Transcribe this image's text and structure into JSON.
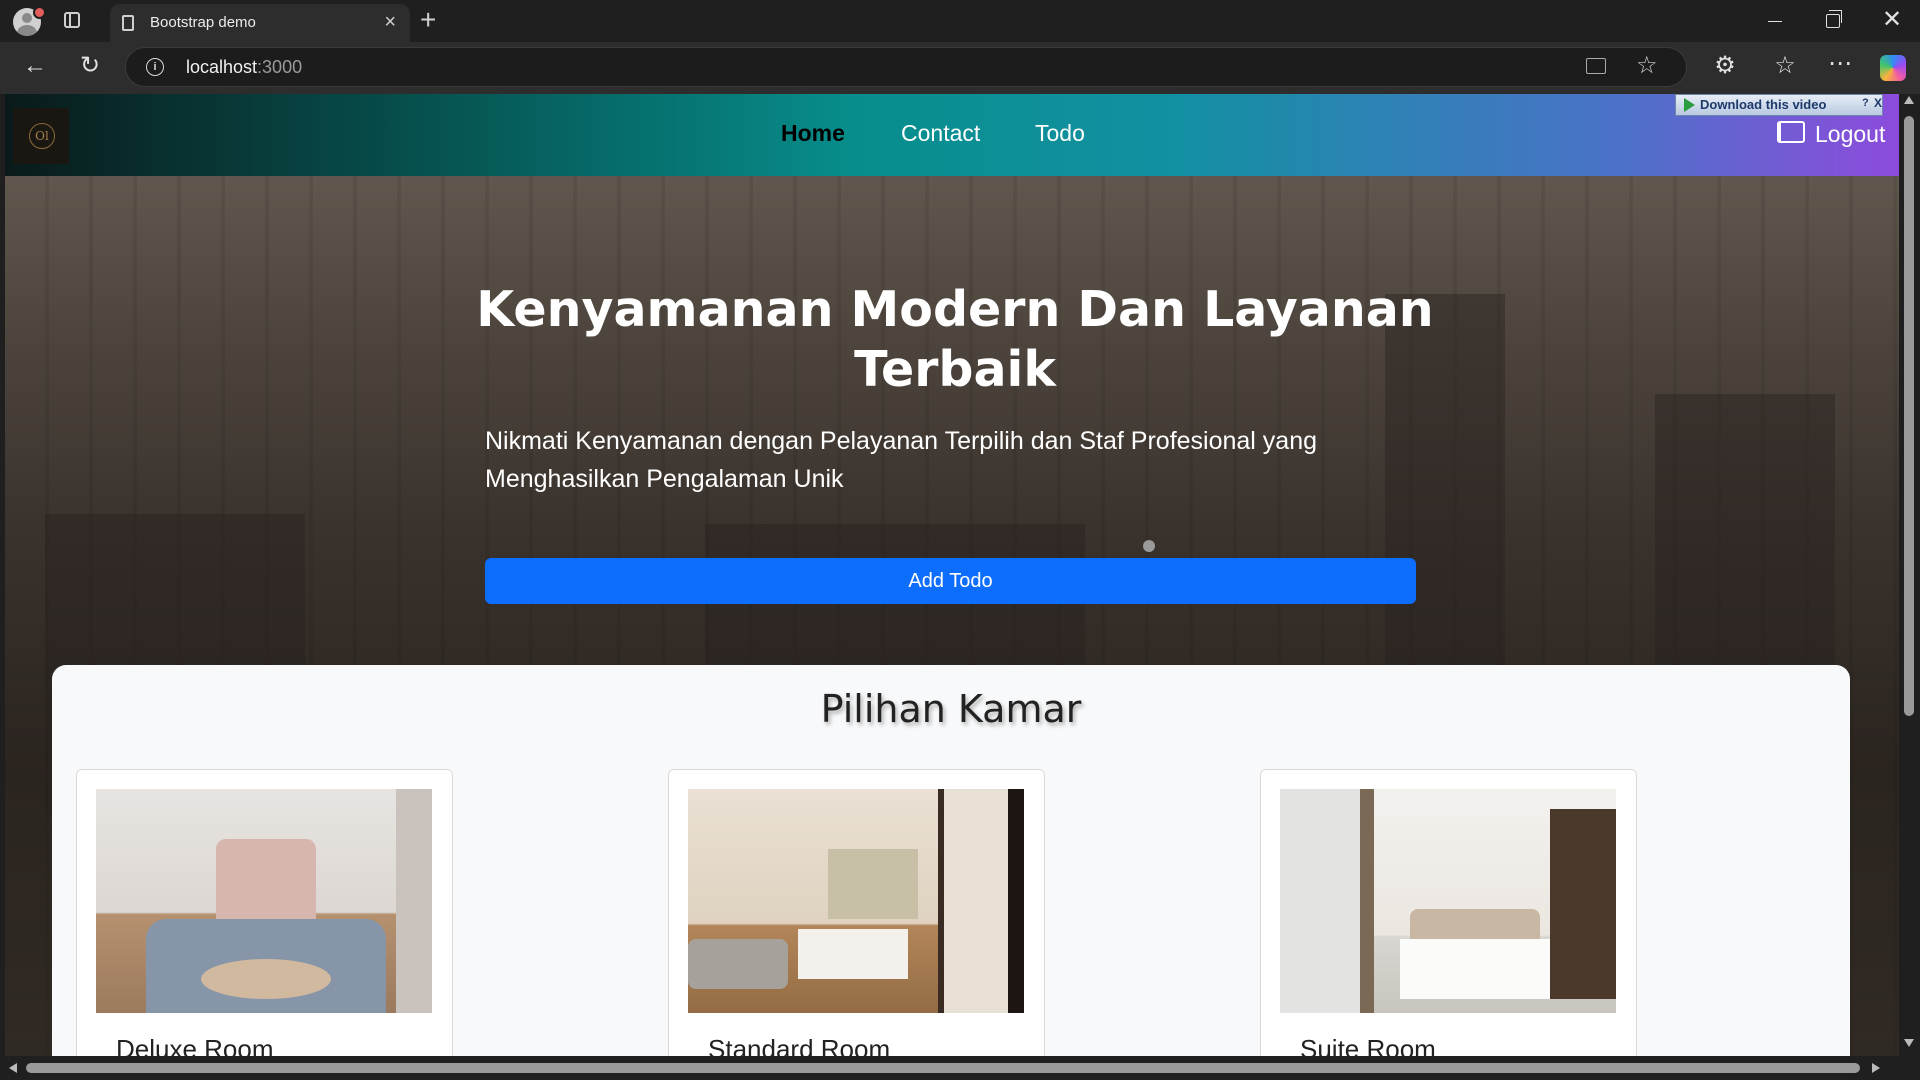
{
  "browser": {
    "tab_title": "Bootstrap demo",
    "tab_close": "×",
    "new_tab": "+",
    "url_host": "localhost",
    "url_port": ":3000",
    "window_close": "✕"
  },
  "toolbar_icons": {
    "back": "←",
    "reload": "↻",
    "extensions": "⚙",
    "favorites": "☆",
    "more": "⋯",
    "star": "☆"
  },
  "navbar": {
    "logo_text": "Ol",
    "links": [
      {
        "label": "Home",
        "active": true
      },
      {
        "label": "Contact",
        "active": false
      },
      {
        "label": "Todo",
        "active": false
      }
    ],
    "logout_label": "Logout"
  },
  "extension_popup": {
    "label": "Download this video",
    "help": "?",
    "close": "X"
  },
  "hero": {
    "title": "Kenyamanan Modern Dan Layanan Terbaik",
    "subtitle": "Nikmati Kenyamanan dengan Pelayanan Terpilih dan Staf Profesional yang Menghasilkan Pengalaman Unik",
    "button_label": "Add Todo"
  },
  "rooms": {
    "title": "Pilihan Kamar",
    "items": [
      {
        "name": "Deluxe Room"
      },
      {
        "name": "Standard Room"
      },
      {
        "name": "Suite Room"
      }
    ]
  },
  "colors": {
    "primary_button": "#0d6efd",
    "navbar_gradient_start": "#06514f",
    "navbar_gradient_end": "#8d4bdc"
  }
}
